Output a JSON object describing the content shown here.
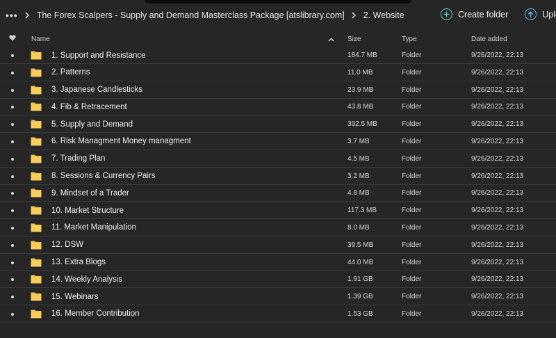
{
  "breadcrumb": {
    "more_label": "•••",
    "items": [
      "The Forex Scalpers - Supply and Demand Masterclass Package [atslibrary.com]",
      "2. Website"
    ]
  },
  "actions": {
    "create_folder": "Create folder",
    "upload": "Upload"
  },
  "table": {
    "headers": {
      "name": "Name",
      "size": "Size",
      "type": "Type",
      "date": "Date added"
    },
    "rows": [
      {
        "name": "1. Support and Resistance",
        "size": "184.7 MB",
        "type": "Folder",
        "date": "9/26/2022, 22:13"
      },
      {
        "name": "2. Patterns",
        "size": "11.0 MB",
        "type": "Folder",
        "date": "9/26/2022, 22:13"
      },
      {
        "name": "3. Japanese Candlesticks",
        "size": "23.9 MB",
        "type": "Folder",
        "date": "9/26/2022, 22:13"
      },
      {
        "name": "4. Fib & Retracement",
        "size": "43.8 MB",
        "type": "Folder",
        "date": "9/26/2022, 22:13"
      },
      {
        "name": "5. Supply and Demand",
        "size": "392.5 MB",
        "type": "Folder",
        "date": "9/26/2022, 22:13"
      },
      {
        "name": "6. Risk Managment Money managment",
        "size": "3.7 MB",
        "type": "Folder",
        "date": "9/26/2022, 22:13"
      },
      {
        "name": "7. Trading Plan",
        "size": "4.5 MB",
        "type": "Folder",
        "date": "9/26/2022, 22:13"
      },
      {
        "name": "8. Sessions & Currency Pairs",
        "size": "3.2 MB",
        "type": "Folder",
        "date": "9/26/2022, 22:13"
      },
      {
        "name": "9. Mindset of a Trader",
        "size": "4.8 MB",
        "type": "Folder",
        "date": "9/26/2022, 22:13"
      },
      {
        "name": "10. Market Structure",
        "size": "117.3 MB",
        "type": "Folder",
        "date": "9/26/2022, 22:13"
      },
      {
        "name": "11. Market Manipulation",
        "size": "8.0 MB",
        "type": "Folder",
        "date": "9/26/2022, 22:13"
      },
      {
        "name": "12. DSW",
        "size": "39.5 MB",
        "type": "Folder",
        "date": "9/26/2022, 22:13"
      },
      {
        "name": "13. Extra Blogs",
        "size": "44.0 MB",
        "type": "Folder",
        "date": "9/26/2022, 22:13"
      },
      {
        "name": "14. Weekly Analysis",
        "size": "1.91 GB",
        "type": "Folder",
        "date": "9/26/2022, 22:13"
      },
      {
        "name": "15. Webinars",
        "size": "1.39 GB",
        "type": "Folder",
        "date": "9/26/2022, 22:13"
      },
      {
        "name": "16. Member Contribution",
        "size": "1.53 GB",
        "type": "Folder",
        "date": "9/26/2022, 22:13"
      }
    ]
  },
  "colors": {
    "background": "#262626",
    "folder": "#f4c34f",
    "create_accent": "#5fc9c0",
    "upload_accent": "#66b7ea"
  },
  "icons": {
    "more": "more-icon",
    "separator": "chevron-right-icon",
    "favorite_header": "heart-icon",
    "sort": "chevron-up-icon",
    "row": "folder-icon",
    "create": "plus-circle-icon",
    "upload": "arrow-up-circle-icon"
  }
}
